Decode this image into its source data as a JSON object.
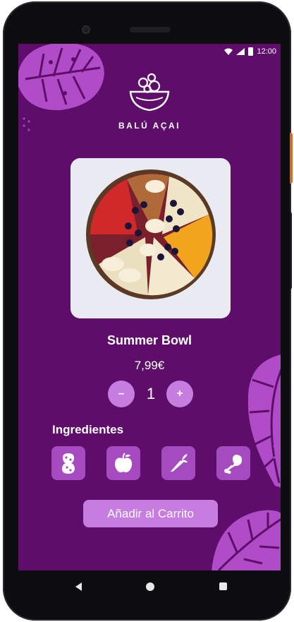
{
  "status_bar": {
    "time": "12:00"
  },
  "brand": {
    "name": "BALÚ AÇAI"
  },
  "product": {
    "name": "Summer Bowl",
    "price": "7,99€",
    "image_icon": "acai-bowl-photo"
  },
  "quantity": {
    "decrement_label": "–",
    "value": "1",
    "increment_label": "+"
  },
  "ingredients": {
    "title": "Ingredientes",
    "items": [
      {
        "icon": "peanut-icon"
      },
      {
        "icon": "apple-icon"
      },
      {
        "icon": "carrot-icon"
      },
      {
        "icon": "chicken-leg-icon"
      }
    ]
  },
  "cart": {
    "add_label": "Añadir al Carrito"
  },
  "colors": {
    "background": "#5e0e6a",
    "accent": "#c77ce0",
    "ingredient_tile": "#a64bbf",
    "leaf": "#b04cc7"
  }
}
